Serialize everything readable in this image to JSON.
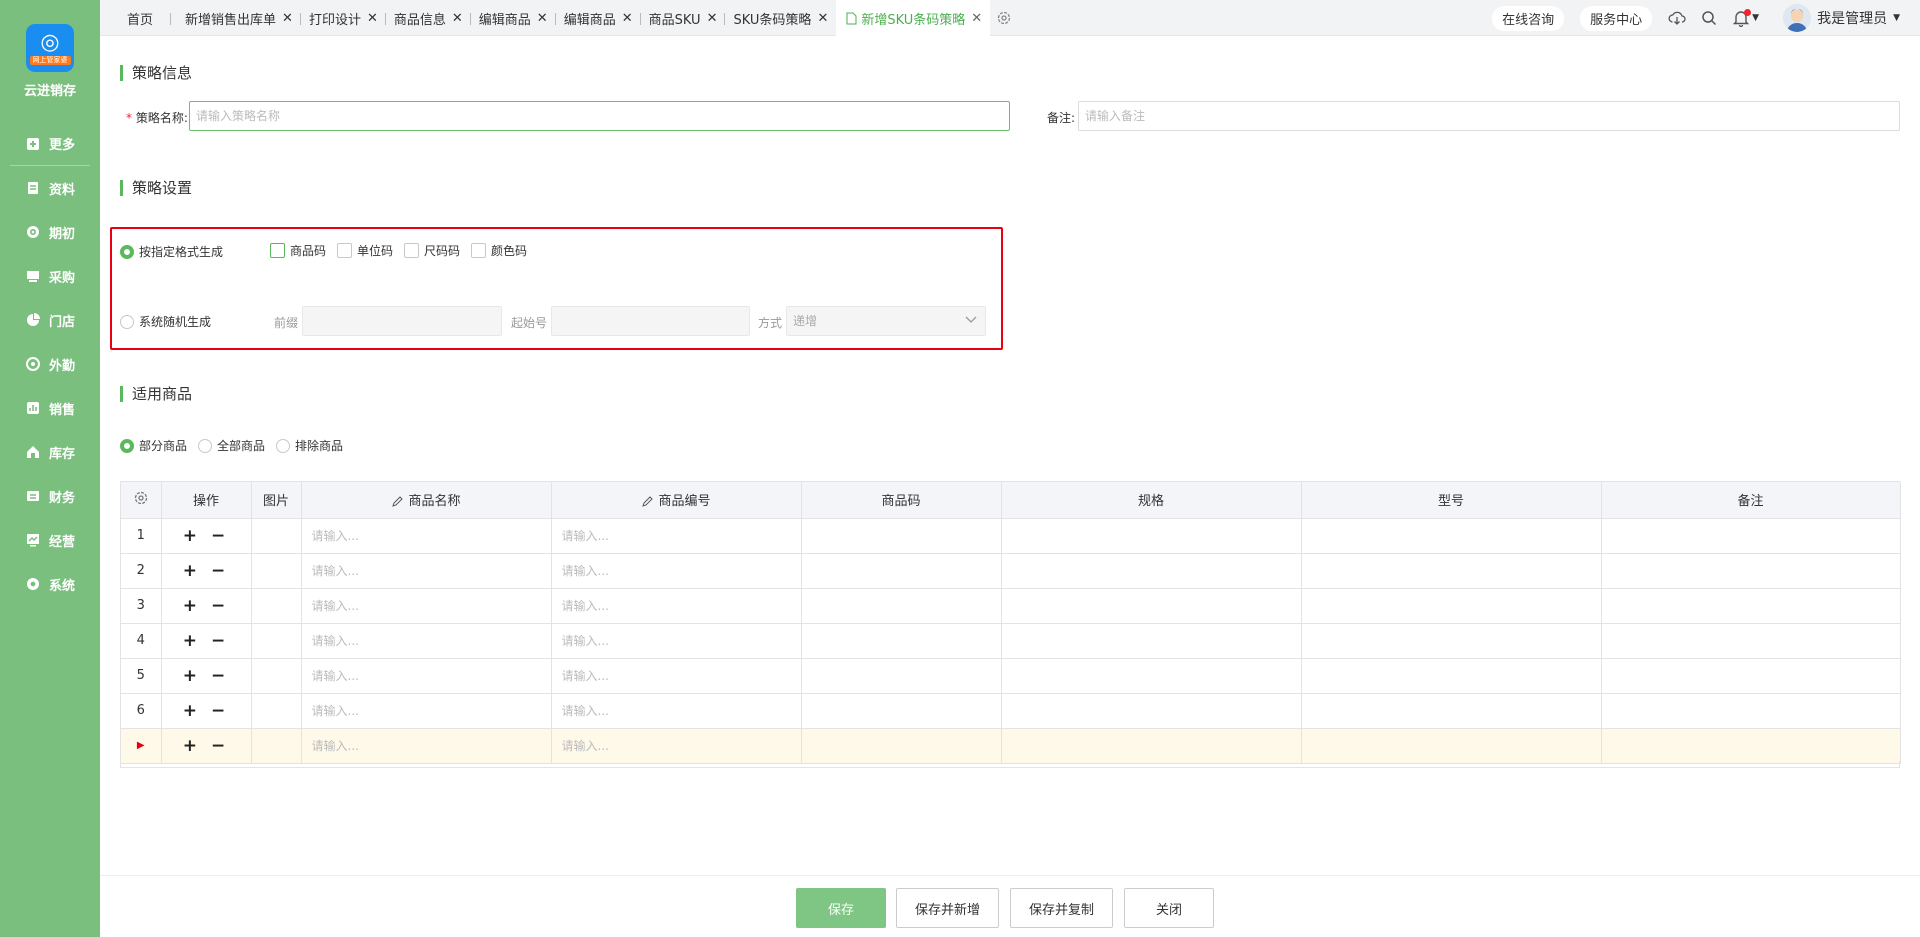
{
  "brand": {
    "name": "云进销存",
    "badge": "网上管家婆"
  },
  "sidebar": {
    "items": [
      {
        "label": "更多",
        "icon": "plus-square-icon"
      },
      {
        "label": "资料",
        "icon": "document-icon"
      },
      {
        "label": "期初",
        "icon": "target-icon"
      },
      {
        "label": "采购",
        "icon": "monitor-icon"
      },
      {
        "label": "门店",
        "icon": "pie-icon"
      },
      {
        "label": "外勤",
        "icon": "compass-icon"
      },
      {
        "label": "销售",
        "icon": "chart-icon"
      },
      {
        "label": "库存",
        "icon": "house-icon"
      },
      {
        "label": "财务",
        "icon": "wallet-icon"
      },
      {
        "label": "经营",
        "icon": "trend-icon"
      },
      {
        "label": "系统",
        "icon": "gear-icon"
      }
    ]
  },
  "tabs": [
    {
      "label": "首页",
      "closable": false
    },
    {
      "label": "新增销售出库单",
      "closable": true
    },
    {
      "label": "打印设计",
      "closable": true
    },
    {
      "label": "商品信息",
      "closable": true
    },
    {
      "label": "编辑商品",
      "closable": true
    },
    {
      "label": "编辑商品",
      "closable": true
    },
    {
      "label": "商品SKU",
      "closable": true
    },
    {
      "label": "SKU条码策略",
      "closable": true
    },
    {
      "label": "新增SKU条码策略",
      "closable": true,
      "active": true
    }
  ],
  "header": {
    "consult": "在线咨询",
    "service": "服务中心",
    "user": "我是管理员"
  },
  "strategy_info": {
    "title": "策略信息",
    "name_label": "策略名称:",
    "name_required": "*",
    "name_placeholder": "请输入策略名称",
    "remark_label": "备注:",
    "remark_placeholder": "请输入备注"
  },
  "strategy_settings": {
    "title": "策略设置",
    "format_option": "按指定格式生成",
    "format_selected": true,
    "checks": [
      "商品码",
      "单位码",
      "尺码码",
      "颜色码"
    ],
    "random_option": "系统随机生成",
    "prefix_label": "前缀",
    "start_label": "起始号",
    "mode_label": "方式",
    "mode_value": "递增"
  },
  "applicable": {
    "title": "适用商品",
    "options": [
      "部分商品",
      "全部商品",
      "排除商品"
    ],
    "selected": "部分商品"
  },
  "table": {
    "columns": [
      "操作",
      "图片",
      "商品名称",
      "商品编号",
      "商品码",
      "规格",
      "型号",
      "备注"
    ],
    "placeholder": "请输入...",
    "rows": [
      "1",
      "2",
      "3",
      "4",
      "5",
      "6",
      "▶"
    ],
    "ops": "+ −"
  },
  "footer": {
    "save": "保存",
    "save_new": "保存并新增",
    "save_copy": "保存并复制",
    "close": "关闭"
  },
  "colors": {
    "sidebar": "#7bbf7f",
    "accent": "#5cb85c",
    "highlight_box": "#e60012",
    "primary_button": "#7fc584"
  }
}
